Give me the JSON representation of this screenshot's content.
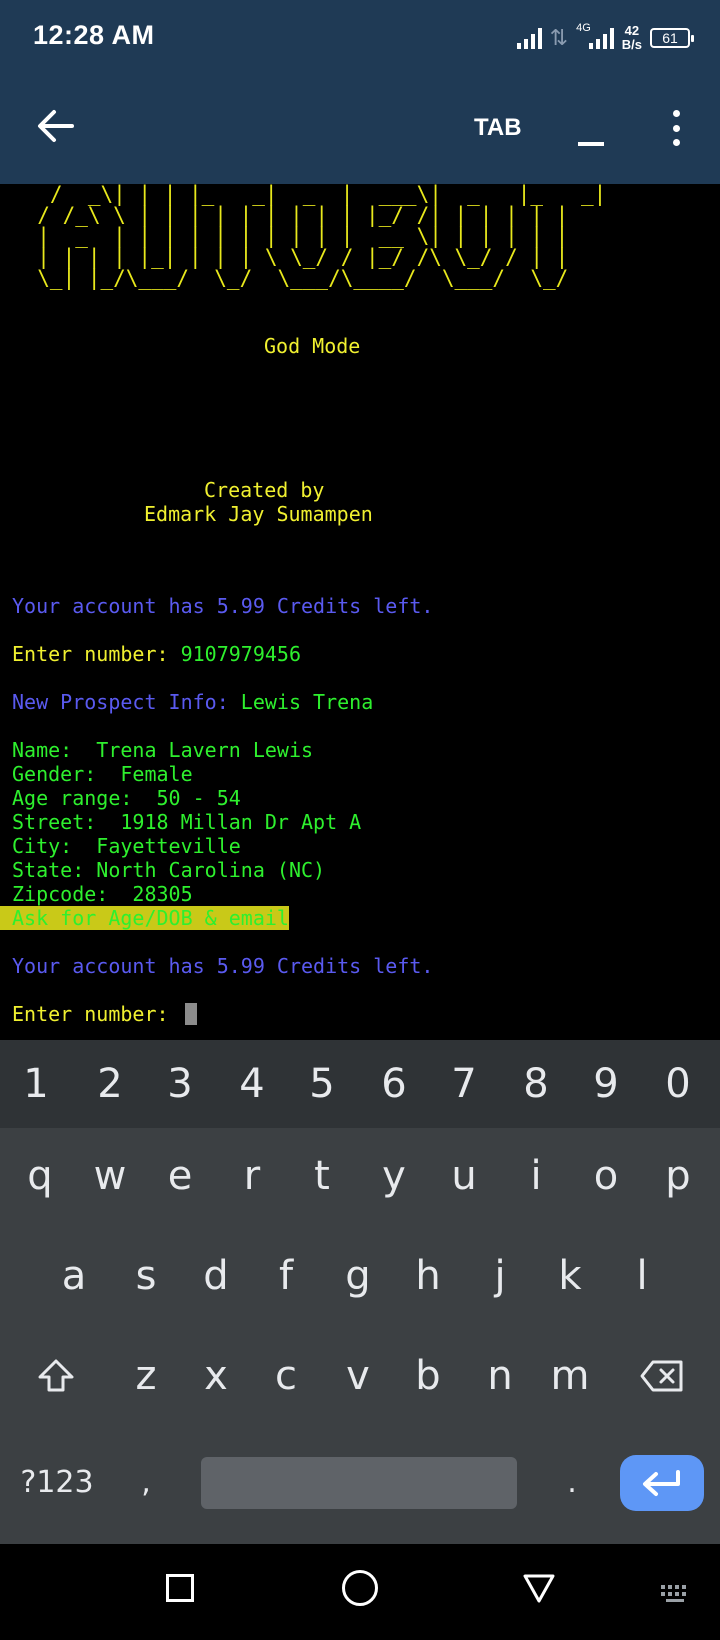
{
  "status_bar": {
    "time": "12:28 AM",
    "network": "4G",
    "speed_value": "42",
    "speed_unit": "B/s",
    "battery": "61"
  },
  "app_bar": {
    "back_icon": "arrow-left-icon",
    "tab_label": "TAB",
    "minimize_icon": "underscore-icon",
    "menu_icon": "more-vertical-icon"
  },
  "terminal": {
    "banner_art": "   /  _\\| | | |_   _|  _  |  ___\\|  _   |_   _|\n  / /_\\ \\ | | | | | | | | | |_/ /| | | | | |\n  |  _  | | | | | | | | | |  __ \\| | | | | |\n  | | | | |_| | | | \\ \\_/ / |_/ /\\ \\_/ / | |\n  \\_| |_/\\___/  \\_/  \\___/\\____/  \\___/  \\_/",
    "mode_label": "God Mode",
    "created_by_label": "Created by",
    "author": "Edmark Jay Sumampen",
    "credits_line_1": "Your account has 5.99 Credits left.",
    "enter_label_1": "Enter number: ",
    "entered_number": "9107979456",
    "prospect_label": "New Prospect Info: ",
    "prospect_name": "Lewis Trena",
    "fields": [
      "Name:  Trena Lavern Lewis",
      "Gender:  Female",
      "Age range:  50 - 54",
      "Street:  1918 Millan Dr Apt A",
      "City:  Fayetteville",
      "State: North Carolina (NC)",
      "Zipcode:  28305"
    ],
    "highlight_note": "Ask for Age/DOB & email",
    "credits_line_2": "Your account has 5.99 Credits left.",
    "enter_label_2": "Enter number: "
  },
  "keyboard": {
    "number_row": [
      "1",
      "2",
      "3",
      "4",
      "5",
      "6",
      "7",
      "8",
      "9",
      "0"
    ],
    "row1": [
      "q",
      "w",
      "e",
      "r",
      "t",
      "y",
      "u",
      "i",
      "o",
      "p"
    ],
    "row2": [
      "a",
      "s",
      "d",
      "f",
      "g",
      "h",
      "j",
      "k",
      "l"
    ],
    "row3": [
      "z",
      "x",
      "c",
      "v",
      "b",
      "n",
      "m"
    ],
    "symbols_key": "?123",
    "comma_key": ",",
    "period_key": ".",
    "shift_icon": "shift-icon",
    "backspace_icon": "backspace-icon",
    "enter_icon": "enter-icon"
  },
  "nav_bar": {
    "recents_icon": "square-icon",
    "home_icon": "circle-icon",
    "back_icon": "triangle-back-icon",
    "keyboard_switch_icon": "keyboard-icon"
  }
}
